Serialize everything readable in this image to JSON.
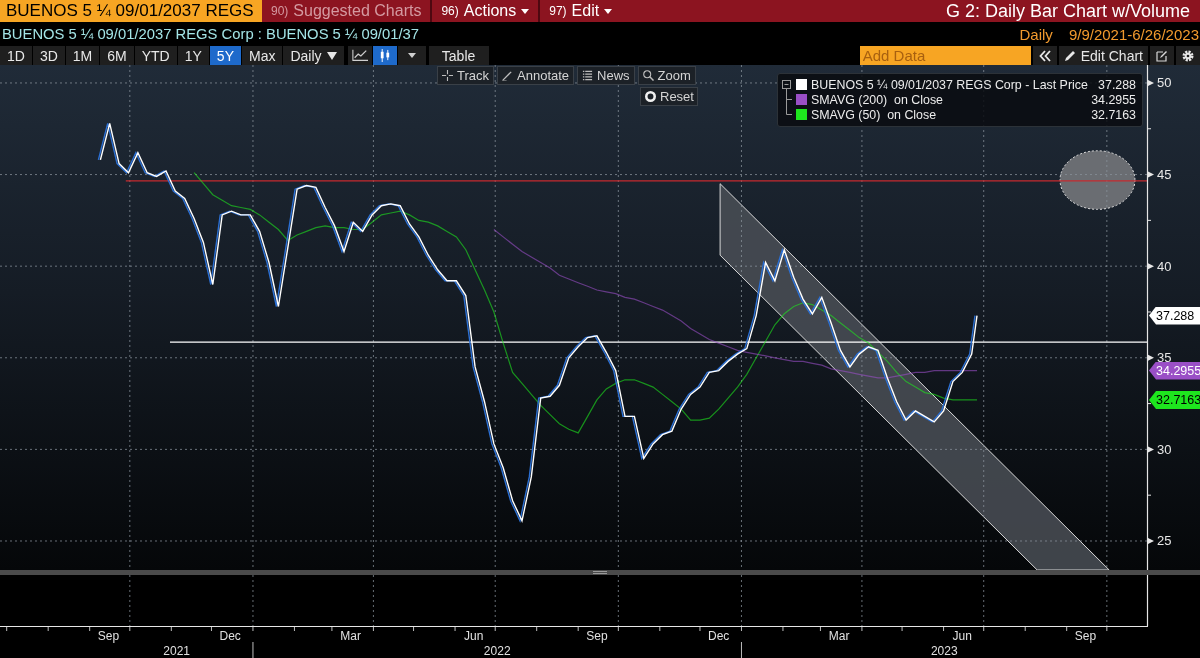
{
  "header": {
    "security": "BUENOS 5 ¼ 09/01/2037 REGS",
    "menus": [
      {
        "number": "90)",
        "label": "Suggested Charts",
        "disabled": true,
        "dropdown": false
      },
      {
        "number": "96)",
        "label": "Actions",
        "disabled": false,
        "dropdown": true
      },
      {
        "number": "97)",
        "label": "Edit",
        "disabled": false,
        "dropdown": true
      }
    ],
    "title": "G 2: Daily Bar Chart w/Volume"
  },
  "subheader": {
    "description": "BUENOS 5 ¼ 09/01/2037 REGS Corp : BUENOS 5 ¼ 09/01/37",
    "frequency": "Daily",
    "date_range": "9/9/2021-6/26/2023"
  },
  "toolbar": {
    "ranges": [
      {
        "label": "1D",
        "selected": false
      },
      {
        "label": "3D",
        "selected": false
      },
      {
        "label": "1M",
        "selected": false
      },
      {
        "label": "6M",
        "selected": false
      },
      {
        "label": "YTD",
        "selected": false
      },
      {
        "label": "1Y",
        "selected": false
      },
      {
        "label": "5Y",
        "selected": true
      },
      {
        "label": "Max",
        "selected": false
      }
    ],
    "frequency_menu": "Daily",
    "chart_types": [
      {
        "kind": "line",
        "selected": false
      },
      {
        "kind": "bar",
        "selected": true
      }
    ],
    "table": "Table",
    "add_data": {
      "placeholder": "Add Data"
    },
    "edit_chart": "Edit Chart"
  },
  "chart": {
    "tools": [
      {
        "kind": "track",
        "label": "Track"
      },
      {
        "kind": "annotate",
        "label": "Annotate"
      },
      {
        "kind": "news",
        "label": "News"
      },
      {
        "kind": "zoom",
        "label": "Zoom"
      }
    ],
    "reset": "Reset",
    "chart_data": {
      "type": "line",
      "x": [
        "2021-09-09",
        "2021-09-16",
        "2021-09-23",
        "2021-09-30",
        "2021-10-07",
        "2021-10-14",
        "2021-10-21",
        "2021-10-28",
        "2021-11-04",
        "2021-11-11",
        "2021-11-18",
        "2021-11-25",
        "2021-12-02",
        "2021-12-09",
        "2021-12-16",
        "2021-12-23",
        "2021-12-30",
        "2022-01-06",
        "2022-01-13",
        "2022-01-20",
        "2022-01-27",
        "2022-02-03",
        "2022-02-10",
        "2022-02-17",
        "2022-02-24",
        "2022-03-03",
        "2022-03-10",
        "2022-03-17",
        "2022-03-24",
        "2022-03-31",
        "2022-04-07",
        "2022-04-14",
        "2022-04-21",
        "2022-04-28",
        "2022-05-05",
        "2022-05-12",
        "2022-05-19",
        "2022-05-26",
        "2022-06-02",
        "2022-06-09",
        "2022-06-16",
        "2022-06-23",
        "2022-06-30",
        "2022-07-07",
        "2022-07-14",
        "2022-07-21",
        "2022-07-28",
        "2022-08-04",
        "2022-08-11",
        "2022-08-18",
        "2022-08-25",
        "2022-09-01",
        "2022-09-08",
        "2022-09-15",
        "2022-09-22",
        "2022-09-29",
        "2022-10-06",
        "2022-10-13",
        "2022-10-20",
        "2022-10-27",
        "2022-11-03",
        "2022-11-10",
        "2022-11-17",
        "2022-11-24",
        "2022-12-01",
        "2022-12-08",
        "2022-12-15",
        "2022-12-22",
        "2022-12-29",
        "2023-01-05",
        "2023-01-12",
        "2023-01-19",
        "2023-01-26",
        "2023-02-02",
        "2023-02-09",
        "2023-02-16",
        "2023-02-23",
        "2023-03-02",
        "2023-03-09",
        "2023-03-16",
        "2023-03-23",
        "2023-03-30",
        "2023-04-06",
        "2023-04-13",
        "2023-04-20",
        "2023-04-27",
        "2023-05-04",
        "2023-05-11",
        "2023-05-18",
        "2023-05-25",
        "2023-06-01",
        "2023-06-08",
        "2023-06-15",
        "2023-06-22",
        "2023-06-26"
      ],
      "series": [
        {
          "name": "BUENOS 5 ¼ 09/01/2037 REGS Corp - Last Price",
          "color": "#ffffff",
          "values": [
            45.8,
            47.8,
            45.6,
            45.1,
            46.2,
            45.1,
            44.9,
            45.2,
            44.1,
            43.7,
            42.6,
            41.3,
            39.0,
            42.8,
            43.0,
            42.8,
            42.8,
            41.9,
            40.2,
            37.8,
            41.0,
            44.2,
            44.4,
            44.3,
            43.2,
            42.2,
            40.8,
            42.4,
            41.9,
            42.8,
            43.3,
            43.4,
            43.3,
            42.3,
            41.6,
            40.6,
            39.8,
            39.2,
            39.2,
            38.4,
            34.5,
            32.6,
            30.3,
            29.0,
            27.2,
            26.1,
            28.5,
            32.8,
            32.9,
            33.5,
            35.0,
            35.6,
            36.1,
            36.2,
            35.3,
            34.3,
            31.8,
            31.8,
            29.5,
            30.3,
            30.8,
            31.0,
            32.2,
            33.0,
            33.4,
            34.2,
            34.3,
            34.8,
            35.2,
            35.5,
            37.3,
            40.2,
            39.2,
            40.9,
            39.4,
            38.2,
            37.4,
            38.3,
            36.9,
            35.4,
            34.5,
            35.2,
            35.6,
            35.4,
            33.9,
            32.6,
            31.6,
            32.1,
            31.8,
            31.5,
            32.1,
            33.7,
            34.2,
            35.2,
            37.3
          ]
        },
        {
          "name": "SMAVG (200)  on Close",
          "color": "#9a4fc6",
          "values": [
            null,
            null,
            null,
            null,
            null,
            null,
            null,
            null,
            null,
            null,
            null,
            null,
            null,
            null,
            null,
            null,
            null,
            null,
            null,
            null,
            null,
            null,
            null,
            null,
            null,
            null,
            null,
            null,
            null,
            null,
            null,
            null,
            null,
            null,
            null,
            null,
            null,
            null,
            null,
            null,
            null,
            null,
            42.0,
            41.6,
            41.2,
            40.8,
            40.5,
            40.2,
            39.9,
            39.5,
            39.3,
            39.1,
            38.9,
            38.7,
            38.6,
            38.5,
            38.3,
            38.2,
            38.0,
            37.8,
            37.6,
            37.3,
            37.0,
            36.6,
            36.3,
            36.0,
            35.8,
            35.6,
            35.4,
            35.3,
            35.2,
            35.1,
            35.0,
            34.9,
            34.8,
            34.8,
            34.7,
            34.6,
            34.4,
            34.3,
            34.2,
            34.1,
            34.0,
            33.9,
            33.9,
            34.0,
            34.1,
            34.2,
            34.2,
            34.3,
            34.3,
            34.3,
            34.3,
            34.3,
            34.3
          ]
        },
        {
          "name": "SMAVG (50)  on Close",
          "color": "#1ee61e",
          "values": [
            null,
            null,
            null,
            null,
            null,
            null,
            null,
            null,
            null,
            null,
            45.1,
            44.5,
            43.9,
            43.6,
            43.3,
            43.2,
            43.1,
            42.8,
            42.4,
            42.0,
            41.4,
            41.7,
            41.9,
            42.1,
            42.2,
            42.1,
            42.1,
            42.0,
            42.0,
            42.4,
            42.8,
            42.9,
            43.0,
            42.8,
            42.5,
            42.4,
            42.2,
            41.9,
            41.6,
            40.9,
            39.8,
            38.7,
            37.5,
            35.8,
            34.2,
            33.6,
            33.0,
            32.4,
            31.9,
            31.4,
            31.1,
            30.9,
            31.8,
            32.7,
            33.3,
            33.6,
            33.8,
            33.8,
            33.6,
            33.4,
            33.0,
            32.6,
            32.2,
            31.6,
            31.6,
            31.7,
            32.2,
            32.8,
            33.4,
            34.1,
            35.0,
            35.9,
            36.8,
            37.4,
            37.8,
            38.0,
            37.9,
            37.6,
            37.3,
            36.9,
            36.5,
            36.1,
            35.8,
            35.3,
            34.8,
            34.2,
            33.7,
            33.4,
            33.1,
            33.0,
            32.8,
            32.7,
            32.7,
            32.7,
            32.7
          ]
        }
      ],
      "xlim": [
        "2021-06-26",
        "2023-10-31"
      ],
      "ylim": [
        20.36,
        50.98
      ],
      "xticks": [
        {
          "value": "2021-09-15",
          "label": "Sep"
        },
        {
          "value": "2021-12-15",
          "label": "Dec"
        },
        {
          "value": "2022-03-15",
          "label": "Mar"
        },
        {
          "value": "2022-06-15",
          "label": "Jun"
        },
        {
          "value": "2022-09-15",
          "label": "Sep"
        },
        {
          "value": "2022-12-15",
          "label": "Dec"
        },
        {
          "value": "2023-03-15",
          "label": "Mar"
        },
        {
          "value": "2023-06-15",
          "label": "Jun"
        },
        {
          "value": "2023-09-15",
          "label": "Sep"
        }
      ],
      "yticks": [
        25,
        30,
        35,
        40,
        45,
        50
      ],
      "grid": true,
      "legend": "upper right",
      "ref_lines": [
        {
          "axis": "y",
          "value": 44.65,
          "color": "#c62a2f"
        },
        {
          "axis": "y",
          "value": 35.85,
          "color": "#ffffff"
        }
      ]
    },
    "legend_values": [
      "37.288",
      "34.2955",
      "32.7163"
    ],
    "axis_tags": [
      "37.288",
      "34.2955",
      "32.7163"
    ],
    "year_labels": [
      "2021",
      "2022",
      "2023"
    ]
  }
}
